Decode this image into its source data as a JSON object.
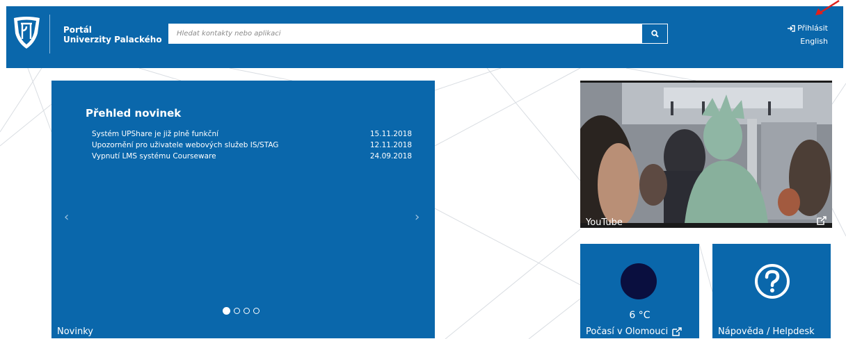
{
  "header": {
    "portal_line1": "Portál",
    "portal_line2": "Univerzity Palackého",
    "search_placeholder": "Hledat kontakty nebo aplikaci",
    "login_label": "Přihlásit",
    "language_label": "English"
  },
  "news": {
    "title": "Přehled novinek",
    "items": [
      {
        "text": "Systém UPShare je již plně funkční",
        "date": "15.11.2018"
      },
      {
        "text": "Upozornění pro uživatele webových služeb IS/STAG",
        "date": "12.11.2018"
      },
      {
        "text": "Vypnutí LMS systému Courseware",
        "date": "24.09.2018"
      }
    ],
    "prev_arrow": "‹",
    "next_arrow": "›",
    "footer_label": "Novinky",
    "slides_total": 4,
    "active_slide": 1
  },
  "video": {
    "label": "YouTube",
    "icon": "external-link-icon"
  },
  "weather": {
    "temperature": "6 °C",
    "label": "Počasí v Olomouci",
    "icon": "moon-icon"
  },
  "help": {
    "label": "Nápověda / Helpdesk",
    "icon": "question-circle-icon"
  },
  "colors": {
    "brand_blue": "#0a67ab",
    "annotation_red": "#e0201b"
  }
}
